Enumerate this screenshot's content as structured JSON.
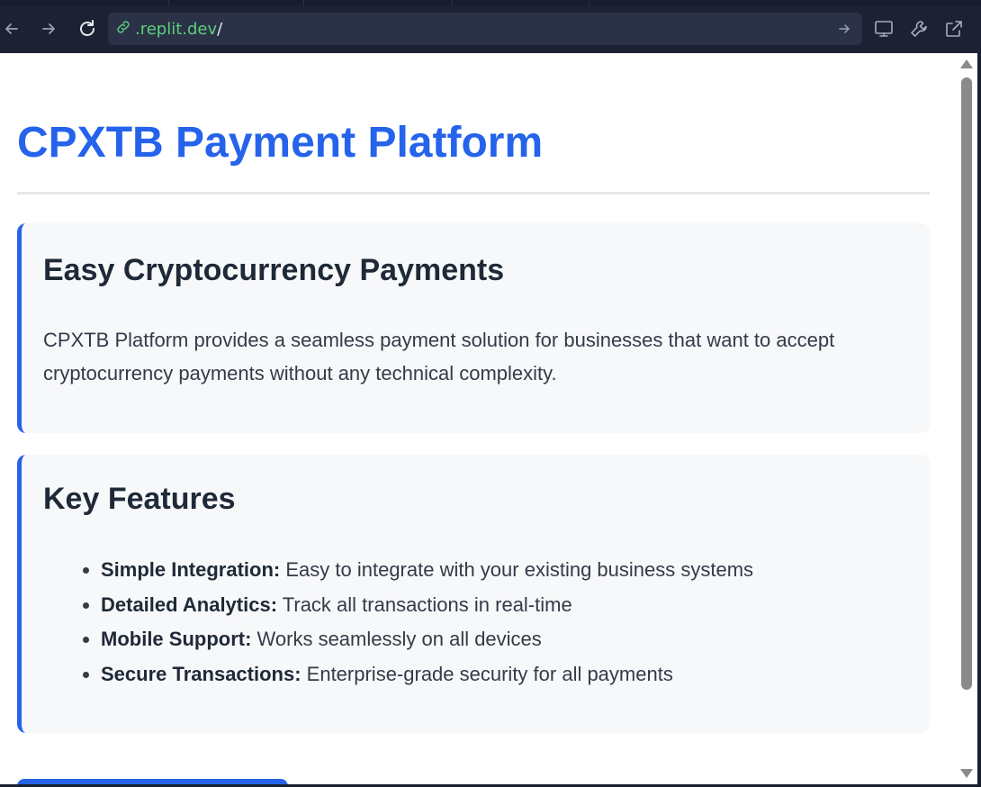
{
  "browser": {
    "url_prefix": "",
    "url_domain": ".replit.dev",
    "url_path": "/",
    "icons": [
      "back-arrow-icon",
      "forward-arrow-icon",
      "reload-icon",
      "link-icon",
      "go-arrow-icon",
      "monitor-icon",
      "wrench-icon",
      "external-link-icon"
    ]
  },
  "page": {
    "title": "CPXTB Payment Platform",
    "intro": {
      "heading": "Easy Cryptocurrency Payments",
      "body": "CPXTB Platform provides a seamless payment solution for businesses that want to accept cryptocurrency payments without any technical complexity."
    },
    "features": {
      "heading": "Key Features",
      "items": [
        {
          "label": "Simple Integration:",
          "text": " Easy to integrate with your existing business systems"
        },
        {
          "label": "Detailed Analytics:",
          "text": " Track all transactions in real-time"
        },
        {
          "label": "Mobile Support:",
          "text": " Works seamlessly on all devices"
        },
        {
          "label": "Secure Transactions:",
          "text": " Enterprise-grade security for all payments"
        }
      ]
    }
  },
  "colors": {
    "accent": "#2563eb",
    "card_bg": "#f7f8fa",
    "heading": "#1f2937",
    "body_text": "#333b48",
    "url_domain": "#5ccf7c",
    "toolbar_bg": "#1c2233"
  }
}
